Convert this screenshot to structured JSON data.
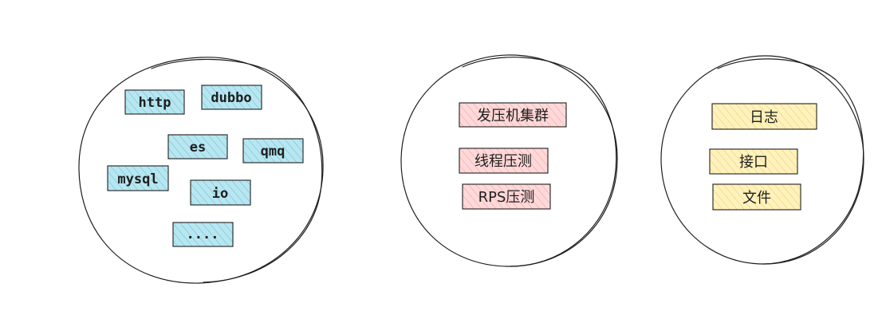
{
  "groups": [
    {
      "items": [
        "http",
        "dubbo",
        "es",
        "qmq",
        "mysql",
        "io",
        "...."
      ],
      "fill_color": "#99d9e8",
      "hatch_color": "#68c2d6"
    },
    {
      "items": [
        "发压机集群",
        "线程压测",
        "RPS压测"
      ],
      "fill_color": "#ffc9c9",
      "hatch_color": "#f39a9a"
    },
    {
      "items": [
        "日志",
        "接口",
        "文件"
      ],
      "fill_color": "#ffec99",
      "hatch_color": "#f0cf6a"
    }
  ],
  "stroke_color": "#1e1e1e"
}
